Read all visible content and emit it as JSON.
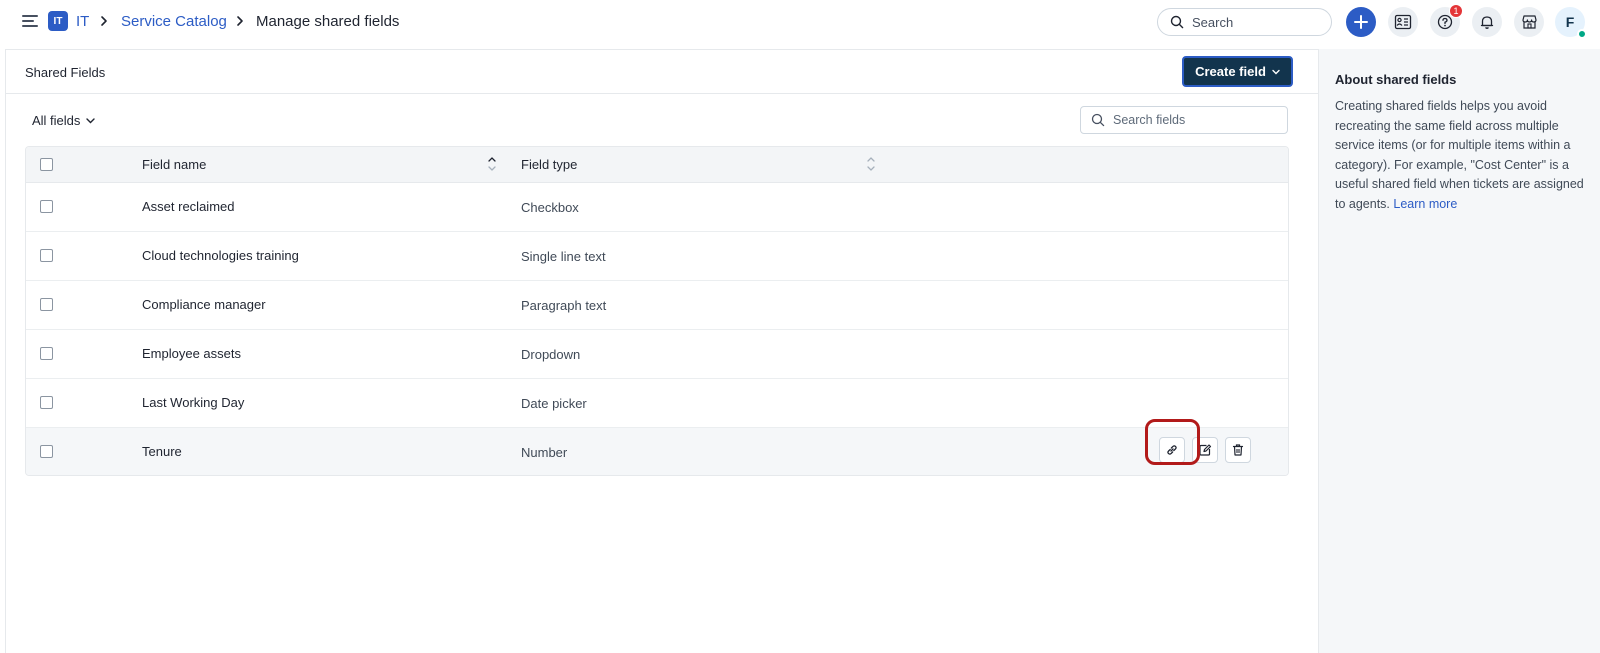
{
  "topbar": {
    "workspace_badge": "IT",
    "breadcrumb": [
      "IT",
      "Service Catalog",
      "Manage shared fields"
    ],
    "search_placeholder": "Search",
    "notification_count": "1",
    "avatar_initial": "F"
  },
  "subheader": {
    "title": "Shared Fields",
    "create_button": "Create field"
  },
  "filters": {
    "view_label": "All fields",
    "search_placeholder": "Search fields"
  },
  "table": {
    "columns": [
      "Field name",
      "Field type"
    ],
    "rows": [
      {
        "name": "Asset reclaimed",
        "type": "Checkbox"
      },
      {
        "name": "Cloud technologies training",
        "type": "Single line text"
      },
      {
        "name": "Compliance manager",
        "type": "Paragraph text"
      },
      {
        "name": "Employee assets",
        "type": "Dropdown"
      },
      {
        "name": "Last Working Day",
        "type": "Date picker"
      },
      {
        "name": "Tenure",
        "type": "Number"
      }
    ]
  },
  "side_panel": {
    "title": "About shared fields",
    "description": "Creating shared fields helps you avoid recreating the same field across multiple service items (or for multiple items within a category). For example, \"Cost Center\" is a useful shared field when tickets are assigned to agents. ",
    "link_text": "Learn more"
  },
  "colors": {
    "brand_blue": "#2c5cc5",
    "primary_dark": "#12344d",
    "highlight_red": "#b21a1a",
    "notification_red": "#e43538",
    "online_green": "#00a886"
  }
}
